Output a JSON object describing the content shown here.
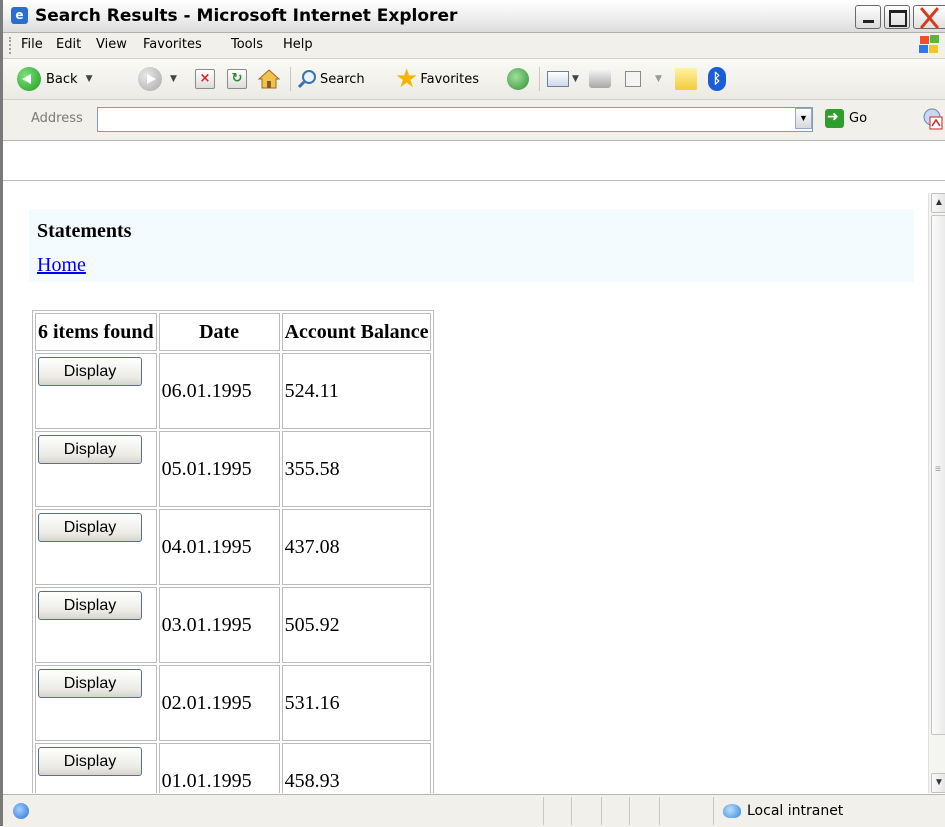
{
  "window": {
    "title": "Search Results - Microsoft Internet Explorer"
  },
  "menu": [
    "File",
    "Edit",
    "View",
    "Favorites",
    "Tools",
    "Help"
  ],
  "toolbar": {
    "back_label": "Back",
    "search_label": "Search",
    "favorites_label": "Favorites"
  },
  "address": {
    "label": "Address",
    "value": "",
    "go_label": "Go"
  },
  "page": {
    "title": "Statements",
    "home_link": "Home",
    "table": {
      "headers": [
        "6 items found",
        "Date",
        "Account Balance"
      ],
      "rows": [
        {
          "button": "Display",
          "date": "06.01.1995",
          "balance": "524.11"
        },
        {
          "button": "Display",
          "date": "05.01.1995",
          "balance": "355.58"
        },
        {
          "button": "Display",
          "date": "04.01.1995",
          "balance": "437.08"
        },
        {
          "button": "Display",
          "date": "03.01.1995",
          "balance": "505.92"
        },
        {
          "button": "Display",
          "date": "02.01.1995",
          "balance": "531.16"
        },
        {
          "button": "Display",
          "date": "01.01.1995",
          "balance": "458.93"
        }
      ]
    }
  },
  "status": {
    "text": "",
    "zone": "Local intranet"
  },
  "icons": [
    "ie-logo-icon",
    "minimize-icon",
    "maximize-icon",
    "close-icon",
    "windows-flag-icon",
    "back-arrow-icon",
    "forward-arrow-icon",
    "stop-icon",
    "refresh-icon",
    "home-icon",
    "search-icon",
    "favorites-star-icon",
    "history-icon",
    "mail-icon",
    "print-icon",
    "edit-icon",
    "note-icon",
    "bluetooth-icon",
    "go-arrow-icon",
    "pdf-icon",
    "page-status-icon",
    "intranet-icon"
  ],
  "colors": {
    "link": "#0000ee",
    "header_band": "#f4fbff",
    "button_border": "#5a6f8c"
  }
}
